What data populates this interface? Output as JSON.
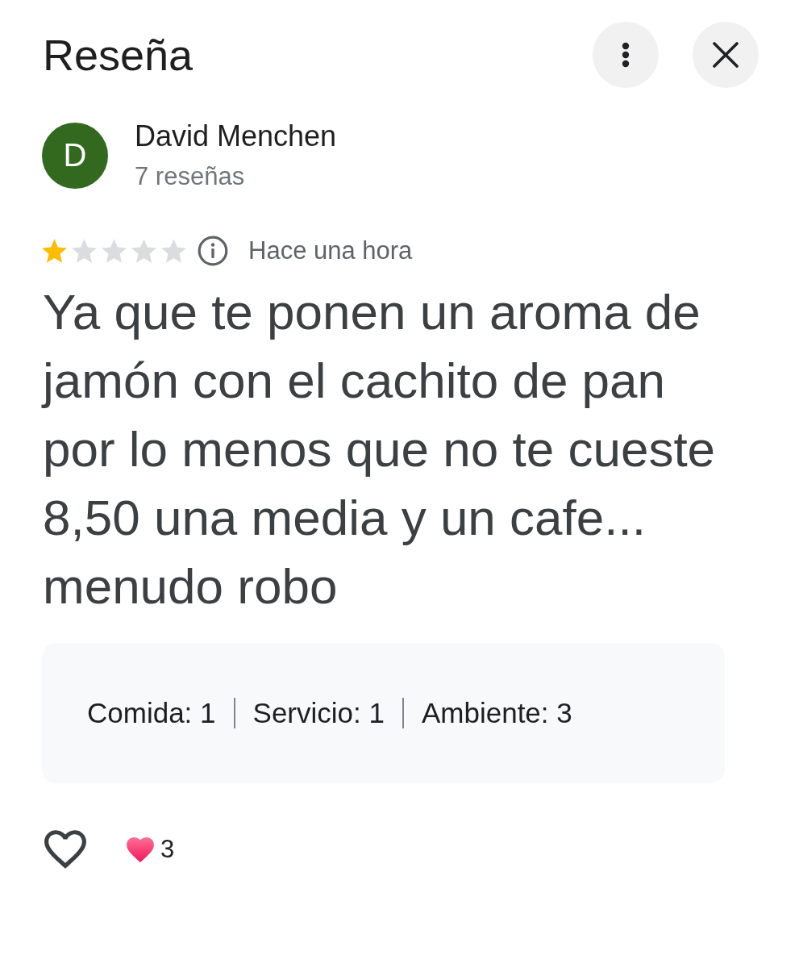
{
  "header": {
    "title": "Reseña"
  },
  "author": {
    "initial": "D",
    "name": "David Menchen",
    "reviews_count": "7 reseñas"
  },
  "review": {
    "stars": 1,
    "time": "Hace una hora",
    "text": "Ya que te ponen un aroma de jamón con el cachito de pan por lo menos que no te cueste 8,50 una media y un cafe... menudo robo"
  },
  "ratings": [
    {
      "label": "Comida:",
      "value": "1"
    },
    {
      "label": "Servicio:",
      "value": "1"
    },
    {
      "label": "Ambiente:",
      "value": "3"
    }
  ],
  "reactions": {
    "count": "3"
  }
}
